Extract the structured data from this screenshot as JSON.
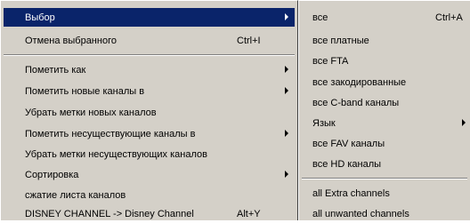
{
  "main_menu": {
    "items": [
      {
        "label": "Выбор",
        "shortcut": "",
        "submenu": true,
        "highlighted": true
      },
      {
        "label": "Отмена выбранного",
        "shortcut": "Ctrl+I",
        "submenu": false
      },
      {
        "label": "Пометить как",
        "shortcut": "",
        "submenu": true
      },
      {
        "label": "Пометить новые каналы в",
        "shortcut": "",
        "submenu": true
      },
      {
        "label": "Убрать метки новых каналов",
        "shortcut": "",
        "submenu": false
      },
      {
        "label": "Пометить несуществующие каналы в",
        "shortcut": "",
        "submenu": true
      },
      {
        "label": "Убрать метки несуществующих каналов",
        "shortcut": "",
        "submenu": false
      },
      {
        "label": "Сортировка",
        "shortcut": "",
        "submenu": true
      },
      {
        "label": "сжатие листа каналов",
        "shortcut": "",
        "submenu": false
      },
      {
        "label": "DISNEY CHANNEL -> Disney Channel",
        "shortcut": "Alt+Y",
        "submenu": false
      }
    ]
  },
  "sub_menu": {
    "items": [
      {
        "label": "все",
        "shortcut": "Ctrl+A",
        "submenu": false
      },
      {
        "label": "все платные",
        "shortcut": "",
        "submenu": false
      },
      {
        "label": "все FTA",
        "shortcut": "",
        "submenu": false
      },
      {
        "label": "все закодированные",
        "shortcut": "",
        "submenu": false
      },
      {
        "label": "все C-band каналы",
        "shortcut": "",
        "submenu": false
      },
      {
        "label": "Язык",
        "shortcut": "",
        "submenu": true
      },
      {
        "label": "все FAV каналы",
        "shortcut": "",
        "submenu": false
      },
      {
        "label": "все HD каналы",
        "shortcut": "",
        "submenu": false
      },
      {
        "label": "all Extra channels",
        "shortcut": "",
        "submenu": false
      },
      {
        "label": "all unwanted channels",
        "shortcut": "",
        "submenu": false
      }
    ]
  },
  "colors": {
    "menu_bg": "#d4d0c8",
    "highlight_bg": "#0a246a",
    "highlight_text": "#ffffff"
  },
  "icons": {
    "submenu_arrow": "chevron-right-icon"
  }
}
